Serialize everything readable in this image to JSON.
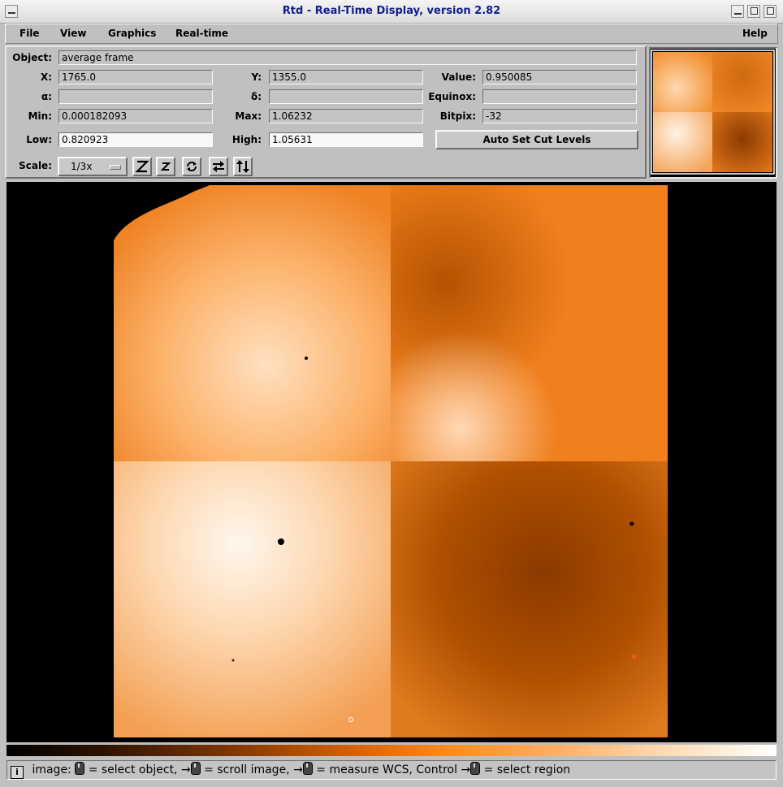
{
  "window": {
    "title": "Rtd - Real-Time Display, version 2.82"
  },
  "menu": {
    "file": "File",
    "view": "View",
    "graphics": "Graphics",
    "realtime": "Real-time",
    "help": "Help"
  },
  "info": {
    "object_label": "Object:",
    "object_value": "average frame",
    "x_label": "X:",
    "x_value": "1765.0",
    "y_label": "Y:",
    "y_value": "1355.0",
    "value_label": "Value:",
    "value_value": "0.950085",
    "alpha_label": "α:",
    "alpha_value": "",
    "delta_label": "δ:",
    "delta_value": "",
    "equinox_label": "Equinox:",
    "equinox_value": "",
    "min_label": "Min:",
    "min_value": "0.000182093",
    "max_label": "Max:",
    "max_value": "1.06232",
    "bitpix_label": "Bitpix:",
    "bitpix_value": "-32",
    "low_label": "Low:",
    "low_value": "0.820923",
    "high_label": "High:",
    "high_value": "1.05631",
    "auto_cut_label": "Auto Set Cut Levels",
    "scale_label": "Scale:",
    "scale_value": "1/3x"
  },
  "toolbar": {
    "icons": [
      "zoom-in-icon",
      "zoom-out-icon",
      "rotate-icon",
      "flip-x-icon",
      "flip-y-icon"
    ]
  },
  "status": {
    "prefix": "image:",
    "part1": "= select object,",
    "part2": "= scroll image,",
    "part3": "= measure WCS, Control",
    "part4": "= select region"
  },
  "colors": {
    "title_text": "#10208a",
    "image_bright": "#ffe6cc",
    "image_mid": "#f07a10",
    "image_dark": "#a84a00"
  }
}
